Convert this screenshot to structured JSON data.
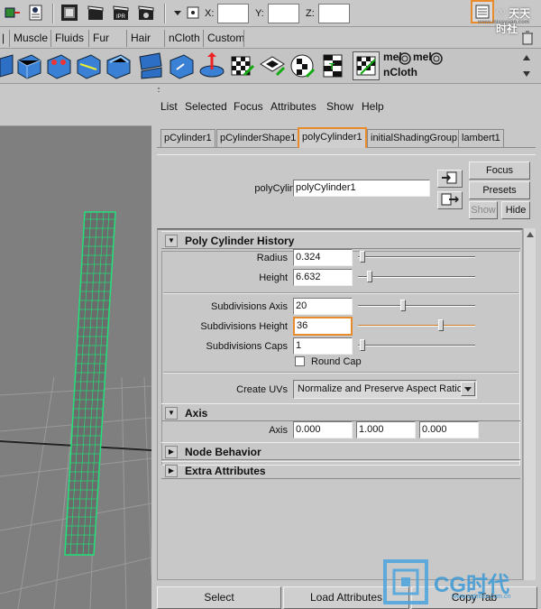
{
  "statusline": {
    "x_label": "X:",
    "y_label": "Y:",
    "z_label": "Z:",
    "x_value": "",
    "y_value": "",
    "z_value": "",
    "watermark_top": "♡ 天天时社",
    "watermark_url": "www.missyuan.com"
  },
  "shelf_tabs": [
    "Muscle",
    "Fluids",
    "Fur",
    "Hair",
    "nCloth",
    "Custom"
  ],
  "shelf": {
    "mel_1": "mel",
    "mel_2": "mel",
    "ncloth_label": "nCloth"
  },
  "ae": {
    "menu": [
      "List",
      "Selected",
      "Focus",
      "Attributes",
      "Show",
      "Help"
    ],
    "tabs": [
      "pCylinder1",
      "pCylinderShape1",
      "polyCylinder1",
      "initialShadingGroup",
      "lambert1"
    ],
    "active_tab_index": 2,
    "node_label": "polyCylinder:",
    "node_value": "polyCylinder1",
    "focus_btn": "Focus",
    "presets_btn": "Presets",
    "show_btn": "Show",
    "hide_btn": "Hide",
    "history": {
      "title": "Poly Cylinder History",
      "radius_label": "Radius",
      "radius_value": "0.324",
      "radius_slider": 0.02,
      "height_label": "Height",
      "height_value": "6.632",
      "height_slider": 0.08,
      "subdiv_axis_label": "Subdivisions Axis",
      "subdiv_axis_value": "20",
      "subdiv_axis_slider": 0.38,
      "subdiv_height_label": "Subdivisions Height",
      "subdiv_height_value": "36",
      "subdiv_height_slider": 0.72,
      "subdiv_caps_label": "Subdivisions Caps",
      "subdiv_caps_value": "1",
      "subdiv_caps_slider": 0.02,
      "round_cap_label": "Round Cap",
      "round_cap_checked": false,
      "create_uvs_label": "Create UVs",
      "create_uvs_value": "Normalize and Preserve Aspect Ratio"
    },
    "axis": {
      "title": "Axis",
      "label": "Axis",
      "x": "0.000",
      "y": "1.000",
      "z": "0.000"
    },
    "node_behavior_title": "Node Behavior",
    "extra_attributes_title": "Extra Attributes"
  },
  "bottom": {
    "select": "Select",
    "load_attributes": "Load Attributes",
    "copy_tab": "Copy Tab"
  },
  "watermark": {
    "cg": "CG时代",
    "url": "www.cgtimes.com.cn"
  },
  "colors": {
    "highlight": "#e98a2b",
    "wireframe": "#22e07a",
    "viewport_bg": "#7f7f7f"
  }
}
